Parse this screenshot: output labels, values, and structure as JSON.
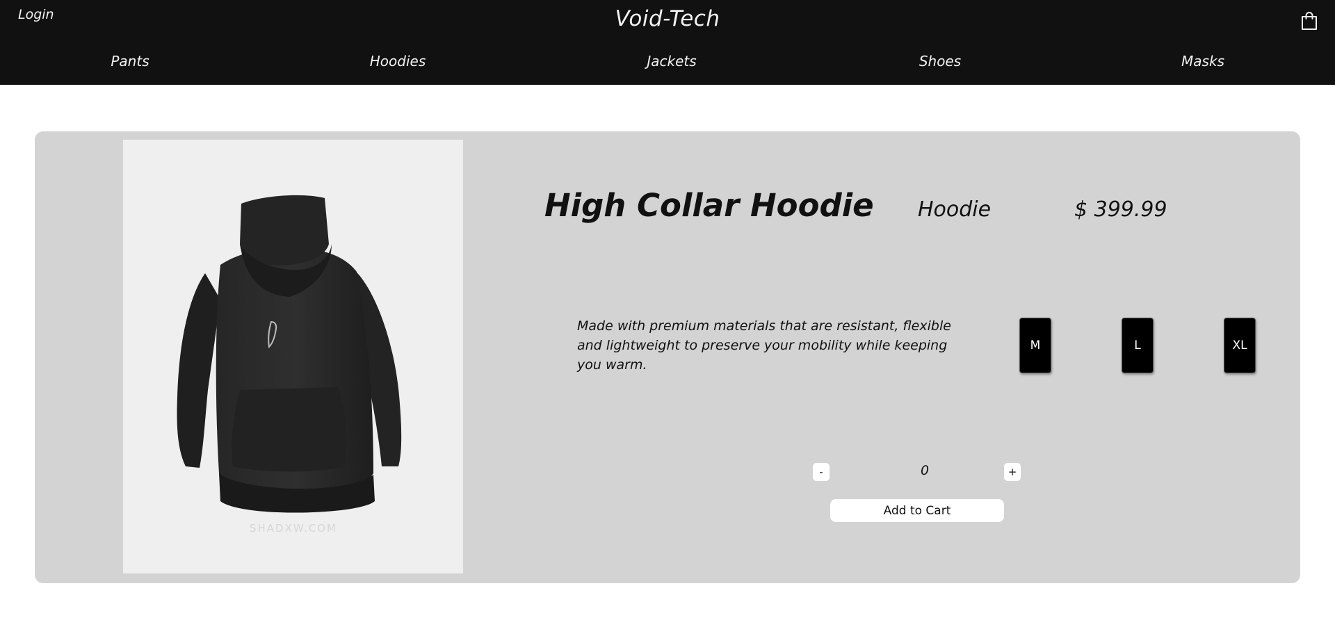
{
  "header": {
    "login_label": "Login",
    "brand": "Void-Tech",
    "cart_icon": "shopping-bag-icon",
    "nav": [
      {
        "label": "Pants"
      },
      {
        "label": "Hoodies"
      },
      {
        "label": "Jackets"
      },
      {
        "label": "Shoes"
      },
      {
        "label": "Masks"
      }
    ]
  },
  "product": {
    "title": "High Collar Hoodie",
    "category": "Hoodie",
    "price": "$ 399.99",
    "description": "Made with premium materials that are resistant, flexible and lightweight to preserve your mobility while keeping you warm.",
    "sizes": [
      "M",
      "L",
      "XL"
    ],
    "quantity": {
      "decrement_label": "-",
      "value": "0",
      "increment_label": "+"
    },
    "add_to_cart_label": "Add to Cart",
    "image_watermark": "SHADXW.COM"
  },
  "colors": {
    "header_bg": "#111111",
    "card_bg": "#d3d3d3",
    "photo_bg": "#efefef",
    "size_button_bg": "#000000"
  }
}
